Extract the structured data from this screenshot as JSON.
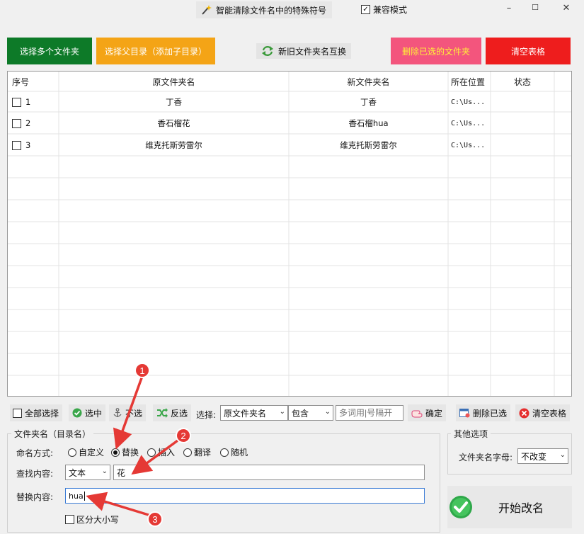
{
  "window": {
    "title": "智能清除文件名中的特殊符号",
    "compat_mode_label": "兼容模式",
    "compat_mode_checked": true,
    "controls": {
      "minimize": "–",
      "maximize": "☐",
      "close": "✕"
    }
  },
  "toolbar": {
    "select_multi_folders": "选择多个文件夹",
    "select_parent_dir": "选择父目录（添加子目录）",
    "swap_names": "新旧文件夹名互换",
    "delete_selected_folders": "删除已选的文件夹",
    "clear_table": "清空表格"
  },
  "table": {
    "columns": [
      "序号",
      "原文件夹名",
      "新文件夹名",
      "所在位置",
      "状态"
    ],
    "rows": [
      {
        "index": "1",
        "original": "丁香",
        "new": "丁香",
        "location": "C:\\Us...",
        "status": ""
      },
      {
        "index": "2",
        "original": "香石榴花",
        "new": "香石榴hua",
        "location": "C:\\Us...",
        "status": ""
      },
      {
        "index": "3",
        "original": "维克托斯劳雷尔",
        "new": "维克托斯劳雷尔",
        "location": "C:\\Us...",
        "status": ""
      }
    ]
  },
  "filter_bar": {
    "select_all": "全部选择",
    "select": "选中",
    "unselect": "不选",
    "invert": "反选",
    "choose_label": "选择:",
    "field_value": "原文件夹名",
    "match_value": "包含",
    "keyword_placeholder": "多词用|号隔开",
    "confirm": "确定",
    "delete_selected": "删除已选",
    "clear_table": "清空表格"
  },
  "rename_panel": {
    "group_title": "文件夹名（目录名）",
    "mode_label": "命名方式:",
    "modes": [
      "自定义",
      "替换",
      "插入",
      "翻译",
      "随机"
    ],
    "selected_mode": "替换",
    "find_label": "查找内容:",
    "find_type": "文本",
    "find_value": "花",
    "replace_label": "替换内容:",
    "replace_value": "hua",
    "case_sensitive_label": "区分大小写"
  },
  "other_options": {
    "group_title": "其他选项",
    "case_label": "文件夹名字母:",
    "case_value": "不改变"
  },
  "start_button": {
    "label": "开始改名"
  },
  "annotations": [
    "1",
    "2",
    "3"
  ],
  "colors": {
    "green_button": "#0d7a28",
    "orange_button": "#f4a416",
    "pink_button": "#f3557d",
    "red_button": "#ee1d1d",
    "annotation_red": "#e53935"
  }
}
